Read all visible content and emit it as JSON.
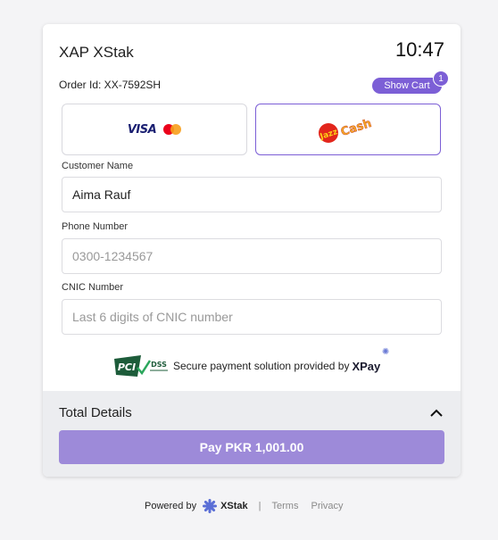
{
  "header": {
    "merchant_name": "XAP XStak",
    "timer": "10:47",
    "order_id": "Order Id: XX-7592SH",
    "show_cart_label": "Show Cart",
    "cart_count": "1"
  },
  "payment_methods": {
    "card_visa_label": "VISA",
    "jazzcash_label": "JazzCash",
    "selected": "jazzcash"
  },
  "form": {
    "customer_name_label": "Customer Name",
    "customer_name_value": "Aima Rauf",
    "phone_label": "Phone Number",
    "phone_placeholder": "0300-1234567",
    "cnic_label": "CNIC Number",
    "cnic_placeholder": "Last 6 digits of CNIC number"
  },
  "security": {
    "pci_label": "PCI",
    "dss_label": "DSS",
    "secure_text": "Secure payment solution provided by",
    "provider": "XPay"
  },
  "totals": {
    "title": "Total Details",
    "pay_button_label": "Pay PKR 1,001.00"
  },
  "footer": {
    "powered_by": "Powered by",
    "brand": "XStak",
    "terms": "Terms",
    "privacy": "Privacy"
  },
  "colors": {
    "accent": "#7c5fd6",
    "pay_button": "#9d8ad9",
    "totals_bg": "#ecedf0"
  }
}
